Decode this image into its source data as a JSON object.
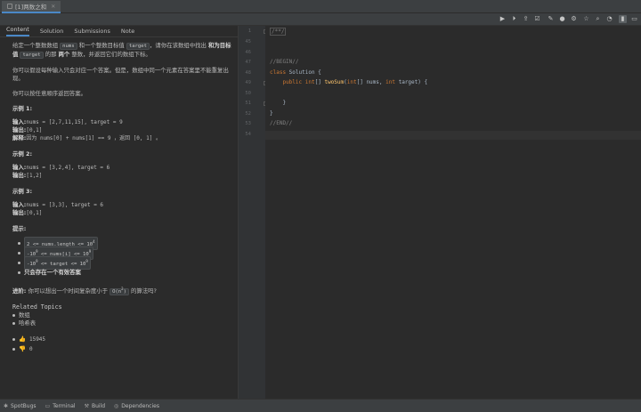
{
  "tab": {
    "title": "[1]两数之和",
    "close": "✕"
  },
  "toolbar": {
    "icons": [
      "run-icon",
      "debug-icon",
      "submit-icon",
      "test-icon",
      "comment-icon",
      "solution-icon",
      "settings-icon",
      "favorite-icon",
      "search-icon",
      "layout-icon",
      "panel-icon"
    ]
  },
  "subtabs": [
    "Content",
    "Solution",
    "Submissions",
    "Note"
  ],
  "problem": {
    "p1": [
      "给定一个整数数组 ",
      "nums",
      " 和一个整数目标值 ",
      "target",
      "，请你在该数组中找出 ",
      "和为目标值",
      " ",
      "target",
      " 的那 ",
      "两个",
      " 整数，并返回它们的数组下标。"
    ],
    "p2": "你可以假设每种输入只会对应一个答案。但是，数组中同一个元素在答案里不能重复出现。",
    "p3": "你可以按任意顺序返回答案。",
    "examples": [
      {
        "title": "示例 1:",
        "lines": [
          {
            "label": "输入: ",
            "text": "nums = [2,7,11,15], target = 9"
          },
          {
            "label": "输出: ",
            "text": "[0,1]"
          },
          {
            "label": "解释: ",
            "text": "因为 nums[0] + nums[1] == 9 ，返回 [0, 1] 。"
          }
        ]
      },
      {
        "title": "示例 2:",
        "lines": [
          {
            "label": "输入: ",
            "text": "nums = [3,2,4], target = 6"
          },
          {
            "label": "输出: ",
            "text": "[1,2]"
          }
        ]
      },
      {
        "title": "示例 3:",
        "lines": [
          {
            "label": "输入: ",
            "text": "nums = [3,3], target = 6"
          },
          {
            "label": "输出: ",
            "text": "[0,1]"
          }
        ]
      }
    ],
    "hint_title": "提示:",
    "hints": [
      {
        "code": "2 <= nums.length <= 10",
        "sup": "4"
      },
      {
        "code": "-10",
        "sup": "9",
        "code2": " <= nums[i] <= 10",
        "sup2": "9"
      },
      {
        "code": "-10",
        "sup": "9",
        "code2": " <= target <= 10",
        "sup2": "9"
      },
      {
        "bold": "只会存在一个有效答案"
      }
    ],
    "followup_label": "进阶: ",
    "followup_text": "你可以想出一个时间复杂度小于 ",
    "followup_code": "O(n",
    "followup_sup": "2",
    "followup_code_end": ")",
    "followup_end": " 的算法吗?",
    "related_title": "Related Topics",
    "topics": [
      "数组",
      "哈希表"
    ],
    "likes": "15945",
    "dislikes": "0"
  },
  "editor": {
    "lines": [
      {
        "num": "1",
        "text": "/**/"
      },
      {
        "num": "45",
        "text": ""
      },
      {
        "num": "46",
        "text": ""
      },
      {
        "num": "47",
        "text": "//BEGIN//"
      },
      {
        "num": "48",
        "text": "class Solution {"
      },
      {
        "num": "49",
        "text": "    public int[] twoSum(int[] nums, int target) {"
      },
      {
        "num": "50",
        "text": ""
      },
      {
        "num": "51",
        "text": "    }"
      },
      {
        "num": "52",
        "text": "}"
      },
      {
        "num": "53",
        "text": "//END//"
      },
      {
        "num": "54",
        "text": ""
      }
    ]
  },
  "bottombar": [
    "SpotBugs",
    "Terminal",
    "Build",
    "Dependencies"
  ]
}
